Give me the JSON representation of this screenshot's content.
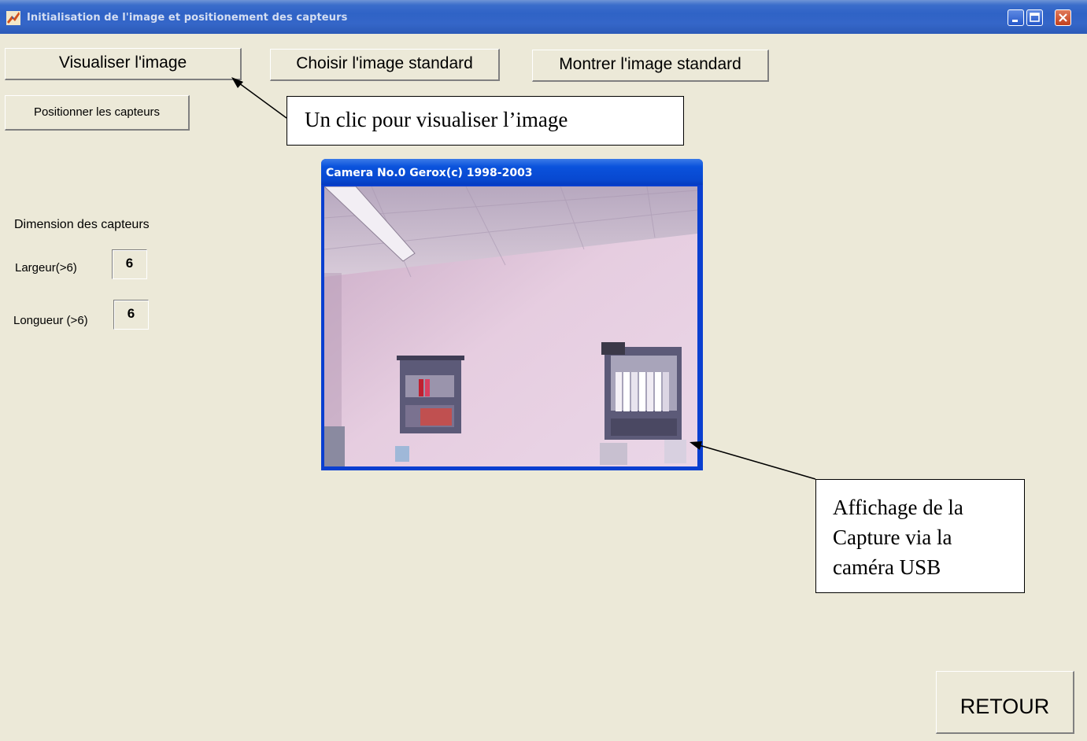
{
  "window": {
    "title": "Initialisation de l'image et positionement des capteurs"
  },
  "toolbar": {
    "visualiser_label": "Visualiser l'image",
    "choisir_label": "Choisir l'image standard",
    "montrer_label": "Montrer l'image standard",
    "positionner_label": "Positionner les capteurs"
  },
  "dimensions": {
    "heading": "Dimension des capteurs",
    "largeur_label": "Largeur(>6)",
    "largeur_value": "6",
    "longueur_label": "Longueur (>6)",
    "longueur_value": "6"
  },
  "camera": {
    "title": "Camera No.0 Gerox(c) 1998-2003"
  },
  "callouts": {
    "visualiser_note": "Un clic pour visualiser l’image",
    "capture_note_line1": "Affichage de la",
    "capture_note_line2": "Capture via la",
    "capture_note_line3": "caméra USB"
  },
  "footer": {
    "retour_label": "RETOUR"
  },
  "colors": {
    "background": "#ece9d8",
    "titlebar": "#2f63c6",
    "camera_frame": "#0a3fd0"
  }
}
